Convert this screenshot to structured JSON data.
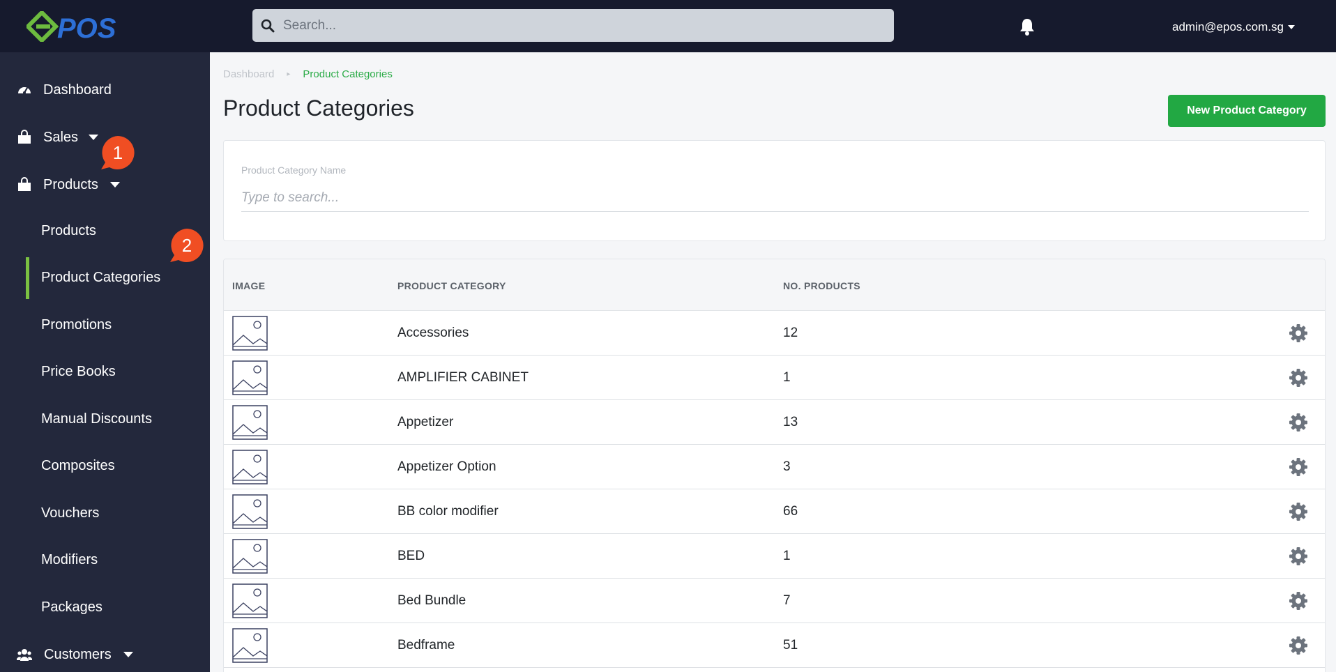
{
  "header": {
    "logo_text": "POS",
    "search_placeholder": "Search...",
    "user_email": "admin@epos.com.sg"
  },
  "sidebar": {
    "items": [
      {
        "label": "Dashboard",
        "icon": "gauge-icon"
      },
      {
        "label": "Sales",
        "icon": "shopping-bag-icon"
      },
      {
        "label": "Products",
        "icon": "shopping-bag-icon"
      }
    ],
    "subitems": [
      "Products",
      "Product Categories",
      "Promotions",
      "Price Books",
      "Manual Discounts",
      "Composites",
      "Vouchers",
      "Modifiers",
      "Packages"
    ],
    "active_subitem": "Product Categories",
    "customers": {
      "label": "Customers",
      "icon": "users-icon"
    }
  },
  "annotations": [
    "1",
    "2"
  ],
  "breadcrumb": {
    "root": "Dashboard",
    "current": "Product Categories"
  },
  "page": {
    "title": "Product Categories",
    "new_button": "New Product Category"
  },
  "filter": {
    "label": "Product Category Name",
    "placeholder": "Type to search..."
  },
  "table": {
    "headers": [
      "IMAGE",
      "PRODUCT CATEGORY",
      "NO. PRODUCTS"
    ],
    "rows": [
      {
        "category": "Accessories",
        "count": "12"
      },
      {
        "category": "AMPLIFIER CABINET",
        "count": "1"
      },
      {
        "category": "Appetizer",
        "count": "13"
      },
      {
        "category": "Appetizer Option",
        "count": "3"
      },
      {
        "category": "BB color modifier",
        "count": "66"
      },
      {
        "category": "BED",
        "count": "1"
      },
      {
        "category": "Bed Bundle",
        "count": "7"
      },
      {
        "category": "Bedframe",
        "count": "51"
      }
    ]
  },
  "colors": {
    "topbar": "#161a2d",
    "sidebar": "#23283c",
    "accent_green": "#22a843",
    "active_bar": "#7bc142",
    "badge": "#f04e23"
  }
}
